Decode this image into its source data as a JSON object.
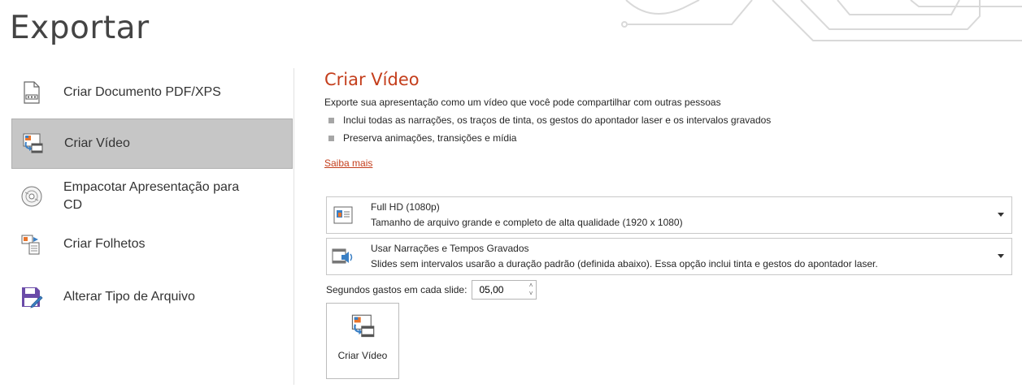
{
  "page": {
    "title": "Exportar"
  },
  "nav": {
    "items": [
      {
        "label": "Criar Documento PDF/XPS",
        "icon": "pdf-document-icon"
      },
      {
        "label": "Criar Vídeo",
        "icon": "video-icon",
        "selected": true
      },
      {
        "label": "Empacotar Apresentação para CD",
        "icon": "cd-icon"
      },
      {
        "label": "Criar Folhetos",
        "icon": "handouts-icon"
      },
      {
        "label": "Alterar Tipo de Arquivo",
        "icon": "save-as-icon"
      }
    ]
  },
  "main": {
    "title": "Criar Vídeo",
    "description": "Exporte sua apresentação como um vídeo que você pode compartilhar com outras pessoas",
    "bullets": [
      "Inclui todas as narrações, os traços de tinta, os gestos do apontador laser e os intervalos gravados",
      "Preserva animações, transições e mídia"
    ],
    "learn_more": "Saiba mais",
    "quality": {
      "title": "Full HD (1080p)",
      "subtitle": "Tamanho de arquivo grande e completo de alta qualidade (1920 x 1080)"
    },
    "narration": {
      "title": "Usar Narrações e Tempos Gravados",
      "subtitle": "Slides sem intervalos usarão a duração padrão (definida abaixo). Essa opção inclui tinta e gestos do apontador laser."
    },
    "seconds": {
      "label": "Segundos gastos em cada slide:",
      "value": "05,00"
    },
    "create_button": {
      "label": "Criar Vídeo"
    }
  },
  "colors": {
    "accent": "#c43e1c",
    "selected_bg": "#c6c6c6",
    "text": "#262626"
  }
}
